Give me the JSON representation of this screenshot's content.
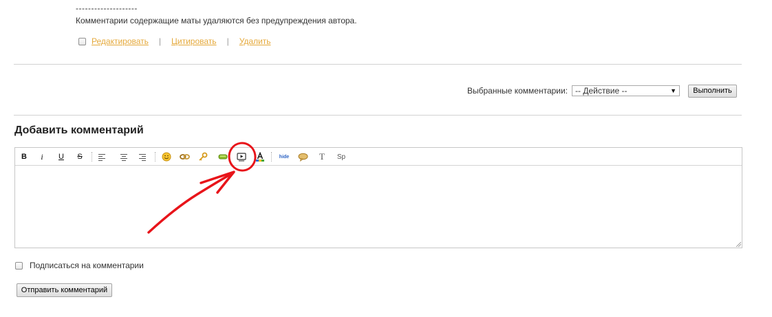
{
  "comment": {
    "dashes": "--------------------",
    "notice": "Комментарии содержащие маты удаляются без предупреждения автора.",
    "actions": {
      "edit": "Редактировать",
      "quote": "Цитировать",
      "delete": "Удалить",
      "separator": "|"
    }
  },
  "selected_comments": {
    "label": "Выбранные комментарии:",
    "select_value": "-- Действие --",
    "execute_label": "Выполнить"
  },
  "add_comment": {
    "title": "Добавить комментарий",
    "toolbar": {
      "bold": "B",
      "italic": "i",
      "underline": "U",
      "strike": "S",
      "hide": "hide",
      "text": "T",
      "spoiler": "Sp"
    },
    "textarea_value": "",
    "subscribe_label": "Подписаться на комментарии",
    "submit_label": "Отправить комментарий"
  },
  "colors": {
    "link": "#e5a93b",
    "annotation": "#e8141a",
    "divider": "#d2d2d2"
  }
}
